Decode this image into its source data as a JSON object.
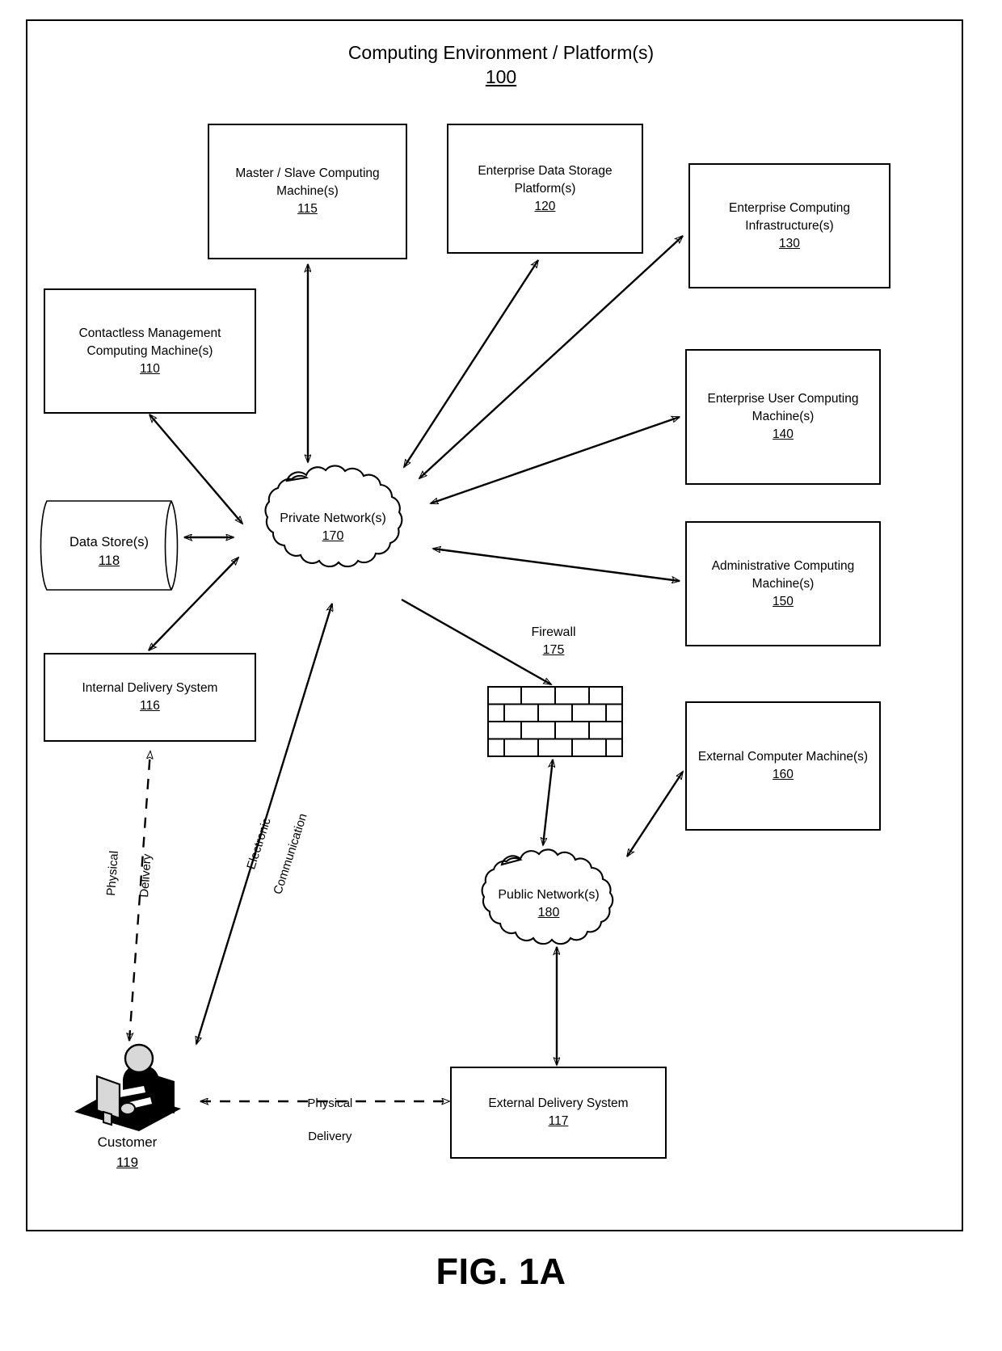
{
  "figure": {
    "caption": "FIG. 1A",
    "environment_title": "Computing Environment / Platform(s)",
    "environment_ref": "100"
  },
  "nodes": {
    "contactless": {
      "line1": "Contactless  Management",
      "line2": "Computing Machine(s)",
      "ref": "110"
    },
    "master_slave": {
      "line1": "Master / Slave Computing",
      "line2": "Machine(s)",
      "ref": "115"
    },
    "internal_delivery": {
      "line1": "Internal Delivery System",
      "line2": "",
      "ref": "116"
    },
    "external_delivery": {
      "line1": "External Delivery System",
      "line2": "",
      "ref": "117"
    },
    "data_store": {
      "line1": "Data Store(s)",
      "ref": "118"
    },
    "customer": {
      "line1": "Customer",
      "ref": "119"
    },
    "enterprise_storage": {
      "line1": "Enterprise Data Storage",
      "line2": "Platform(s)",
      "ref": "120"
    },
    "enterprise_infra": {
      "line1": "Enterprise Computing",
      "line2": "Infrastructure(s)",
      "ref": "130"
    },
    "enterprise_user": {
      "line1": "Enterprise User Computing",
      "line2": "Machine(s)",
      "ref": "140"
    },
    "administrative": {
      "line1": "Administrative Computing",
      "line2": "Machine(s)",
      "ref": "150"
    },
    "external_computer": {
      "line1": "External Computer Machine(s)",
      "line2": "",
      "ref": "160"
    },
    "private_network": {
      "line1": "Private Network(s)",
      "ref": "170"
    },
    "firewall": {
      "line1": "Firewall",
      "ref": "175"
    },
    "public_network": {
      "line1": "Public Network(s)",
      "ref": "180"
    }
  },
  "edge_labels": {
    "physical_delivery_vertical_line1": "Physical",
    "physical_delivery_vertical_line2": "Delivery",
    "electronic_communication_line1": "Electronic",
    "electronic_communication_line2": "Communication",
    "physical_delivery_horizontal_line1": "Physical",
    "physical_delivery_horizontal_line2": "Delivery"
  },
  "colors": {
    "stroke": "#000000",
    "background": "#ffffff"
  }
}
